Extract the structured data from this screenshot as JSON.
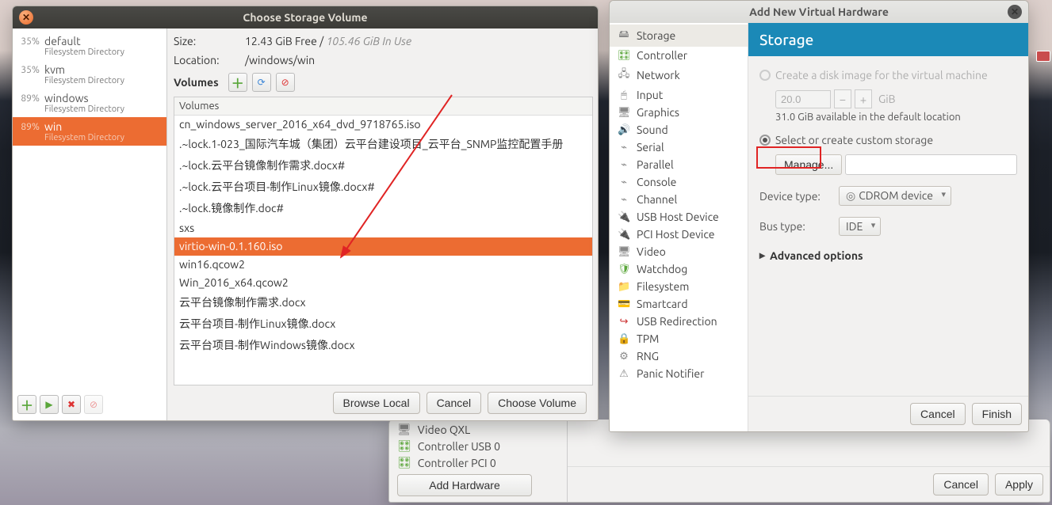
{
  "storage_dialog": {
    "title": "Choose Storage Volume",
    "pools": [
      {
        "pct": "35%",
        "name": "default",
        "subtitle": "Filesystem Directory",
        "selected": false
      },
      {
        "pct": "35%",
        "name": "kvm",
        "subtitle": "Filesystem Directory",
        "selected": false
      },
      {
        "pct": "89%",
        "name": "windows",
        "subtitle": "Filesystem Directory",
        "selected": false
      },
      {
        "pct": "89%",
        "name": "win",
        "subtitle": "Filesystem Directory",
        "selected": true
      }
    ],
    "info": {
      "size_label": "Size:",
      "free": "12.43 GiB Free",
      "sep": " / ",
      "in_use": "105.46 GiB In Use",
      "location_label": "Location:",
      "location": "/windows/win"
    },
    "volumes_label": "Volumes",
    "list_header": "Volumes",
    "volumes": [
      {
        "name": "cn_windows_server_2016_x64_dvd_9718765.iso"
      },
      {
        "name": ".~lock.1-023_国际汽车城（集团）云平台建设项目_云平台_SNMP监控配置手册"
      },
      {
        "name": ".~lock.云平台镜像制作需求.docx#"
      },
      {
        "name": ".~lock.云平台项目-制作Linux镜像.docx#"
      },
      {
        "name": ".~lock.镜像制作.doc#"
      },
      {
        "name": "sxs"
      },
      {
        "name": "virtio-win-0.1.160.iso",
        "selected": true
      },
      {
        "name": "win16.qcow2"
      },
      {
        "name": "Win_2016_x64.qcow2"
      },
      {
        "name": "云平台镜像制作需求.docx"
      },
      {
        "name": "云平台项目-制作Linux镜像.docx"
      },
      {
        "name": "云平台项目-制作Windows镜像.docx"
      }
    ],
    "buttons": {
      "browse": "Browse Local",
      "cancel": "Cancel",
      "choose": "Choose Volume"
    }
  },
  "add_hardware": {
    "title": "Add New Virtual Hardware",
    "hw_types": [
      {
        "label": "Storage",
        "glyph": "🖴",
        "cls": "glyph-grey",
        "selected": true
      },
      {
        "label": "Controller",
        "glyph": "🎛",
        "cls": "glyph-green"
      },
      {
        "label": "Network",
        "glyph": "🖧",
        "cls": "glyph-grey"
      },
      {
        "label": "Input",
        "glyph": "🖱",
        "cls": "glyph-grey"
      },
      {
        "label": "Graphics",
        "glyph": "🖥",
        "cls": "glyph-grey"
      },
      {
        "label": "Sound",
        "glyph": "🔊",
        "cls": "glyph-orange"
      },
      {
        "label": "Serial",
        "glyph": "⌁",
        "cls": "glyph-grey"
      },
      {
        "label": "Parallel",
        "glyph": "⌁",
        "cls": "glyph-grey"
      },
      {
        "label": "Console",
        "glyph": "⌁",
        "cls": "glyph-grey"
      },
      {
        "label": "Channel",
        "glyph": "⌁",
        "cls": "glyph-grey"
      },
      {
        "label": "USB Host Device",
        "glyph": "🔌",
        "cls": "glyph-grey"
      },
      {
        "label": "PCI Host Device",
        "glyph": "🔌",
        "cls": "glyph-grey"
      },
      {
        "label": "Video",
        "glyph": "🖥",
        "cls": "glyph-grey"
      },
      {
        "label": "Watchdog",
        "glyph": "🛡",
        "cls": "glyph-green"
      },
      {
        "label": "Filesystem",
        "glyph": "📁",
        "cls": "glyph-orange"
      },
      {
        "label": "Smartcard",
        "glyph": "💳",
        "cls": "glyph-grey"
      },
      {
        "label": "USB Redirection",
        "glyph": "↪",
        "cls": "glyph-red"
      },
      {
        "label": "TPM",
        "glyph": "🔒",
        "cls": "glyph-grey"
      },
      {
        "label": "RNG",
        "glyph": "⚙",
        "cls": "glyph-grey"
      },
      {
        "label": "Panic Notifier",
        "glyph": "⚠",
        "cls": "glyph-grey"
      }
    ],
    "form": {
      "header": "Storage",
      "opt_disk": "Create a disk image for the virtual machine",
      "disk_size": "20.0",
      "disk_unit": "GiB",
      "available": "31.0 GiB available in the default location",
      "opt_custom": "Select or create custom storage",
      "manage_btn": "Manage...",
      "device_type_label": "Device type:",
      "device_type": "CDROM device",
      "bus_type_label": "Bus type:",
      "bus_type": "IDE",
      "advanced": "Advanced options",
      "cancel": "Cancel",
      "finish": "Finish"
    }
  },
  "vm_details": {
    "devices": [
      {
        "glyph": "🖥",
        "cls": "glyph-grey",
        "label": "Video QXL"
      },
      {
        "glyph": "🎛",
        "cls": "glyph-green",
        "label": "Controller USB 0"
      },
      {
        "glyph": "🎛",
        "cls": "glyph-green",
        "label": "Controller PCI 0"
      }
    ],
    "add_hw_btn": "Add Hardware",
    "cancel": "Cancel",
    "apply": "Apply"
  }
}
